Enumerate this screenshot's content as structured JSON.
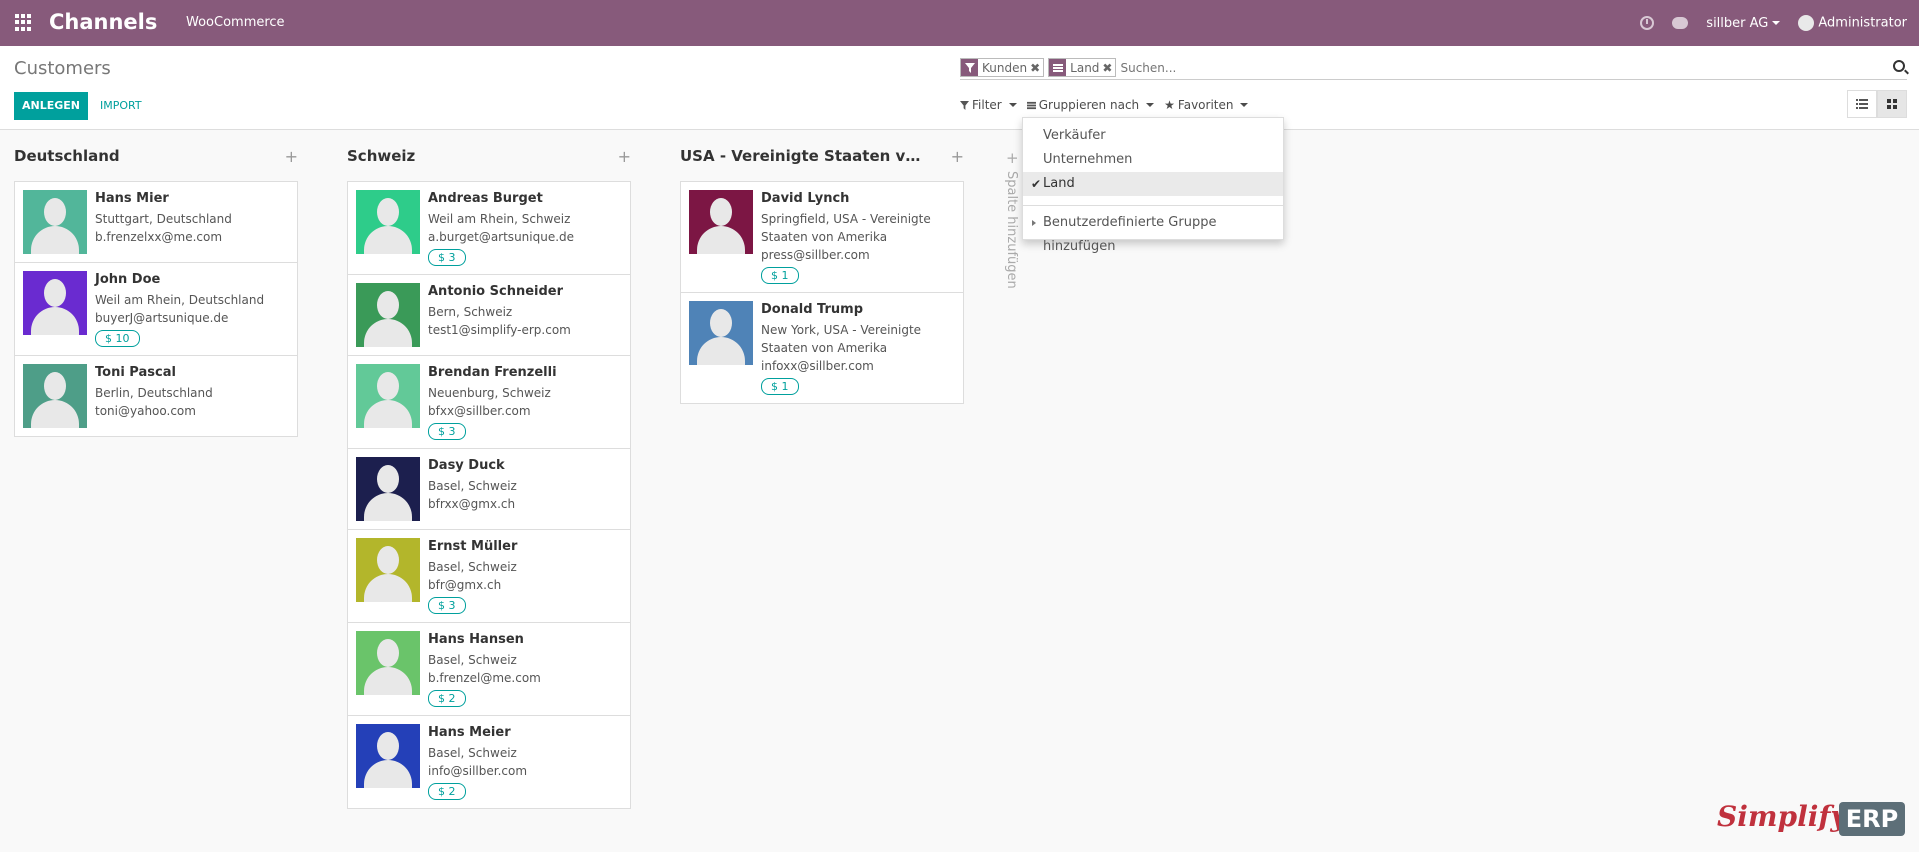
{
  "navbar": {
    "app_title": "Channels",
    "menu_woocommerce": "WooCommerce",
    "company": "sillber AG",
    "user": "Administrator"
  },
  "control": {
    "breadcrumb": "Customers",
    "create_label": "ANLEGEN",
    "import_label": "IMPORT",
    "facets": [
      {
        "label": "Kunden"
      },
      {
        "label": "Land"
      }
    ],
    "search_placeholder": "Suchen...",
    "filter_label": "Filter",
    "groupby_label": "Gruppieren nach",
    "favorites_label": "Favoriten"
  },
  "groupby_menu": {
    "items": [
      {
        "label": "Verkäufer",
        "checked": false
      },
      {
        "label": "Unternehmen",
        "checked": false
      },
      {
        "label": "Land",
        "checked": true
      }
    ],
    "custom_group": "Benutzerdefinierte Gruppe hinzufügen"
  },
  "kanban": {
    "add_column": "Spalte hinzufügen",
    "columns": [
      {
        "title": "Deutschland",
        "cards": [
          {
            "name": "Hans Mier",
            "location": "Stuttgart, Deutschland",
            "email": "b.frenzelxx@me.com",
            "badge": "",
            "color": "#52b69a"
          },
          {
            "name": "John Doe",
            "location": "Weil am Rhein, Deutschland",
            "email": "buyerJ@artsunique.de",
            "badge": "$ 10",
            "color": "#6a2bd0"
          },
          {
            "name": "Toni Pascal",
            "location": "Berlin, Deutschland",
            "email": "toni@yahoo.com",
            "badge": "",
            "color": "#4e9e88"
          }
        ]
      },
      {
        "title": "Schweiz",
        "cards": [
          {
            "name": "Andreas Burget",
            "location": "Weil am Rhein, Schweiz",
            "email": "a.burget@artsunique.de",
            "badge": "$ 3",
            "color": "#2ecc8a"
          },
          {
            "name": "Antonio Schneider",
            "location": "Bern, Schweiz",
            "email": "test1@simplify-erp.com",
            "badge": "",
            "color": "#3a9a58"
          },
          {
            "name": "Brendan Frenzelli",
            "location": "Neuenburg, Schweiz",
            "email": "bfxx@sillber.com",
            "badge": "$ 3",
            "color": "#62c998"
          },
          {
            "name": "Dasy Duck",
            "location": "Basel, Schweiz",
            "email": "bfrxx@gmx.ch",
            "badge": "",
            "color": "#1c1f4e"
          },
          {
            "name": "Ernst Müller",
            "location": "Basel, Schweiz",
            "email": "bfr@gmx.ch",
            "badge": "$ 3",
            "color": "#b3b62b"
          },
          {
            "name": "Hans Hansen",
            "location": "Basel, Schweiz",
            "email": "b.frenzel@me.com",
            "badge": "$ 2",
            "color": "#6ac46a"
          },
          {
            "name": "Hans Meier",
            "location": "Basel, Schweiz",
            "email": "info@sillber.com",
            "badge": "$ 2",
            "color": "#2440b8"
          }
        ]
      },
      {
        "title": "USA - Vereinigte Staaten von Am...",
        "cards": [
          {
            "name": "David Lynch",
            "location": "Springfield, USA - Vereinigte Staaten von Amerika",
            "email": "press@sillber.com",
            "badge": "$ 1",
            "color": "#7c1644"
          },
          {
            "name": "Donald Trump",
            "location": "New York, USA - Vereinigte Staaten von Amerika",
            "email": "infoxx@sillber.com",
            "badge": "$ 1",
            "color": "#4f83b7"
          }
        ]
      }
    ]
  },
  "watermark": {
    "brand_left": "Simplify",
    "brand_right": "ERP"
  },
  "colors": {
    "brand": "#875a7b",
    "accent": "#00a09d"
  }
}
